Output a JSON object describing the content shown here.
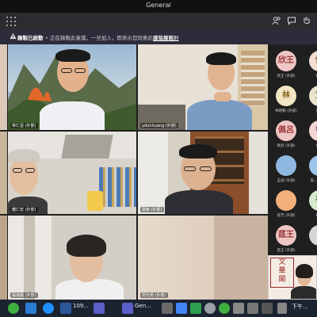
{
  "window": {
    "title": "General"
  },
  "banner": {
    "bold": "錄製已啟動",
    "message": "• 正在錄製此會議，一旦加入，即表示您同意此會議錄製。",
    "link": "隱私權原則"
  },
  "participants": {
    "tile_names": [
      "林仁昱 (外部)",
      "ydunhuang (外部)",
      "",
      "鍾仁宏 (外部)",
      "梁敏 (外部)",
      "",
      "張淑鳳 (外部)",
      "周光苑 (外部)",
      ""
    ]
  },
  "roster": [
    {
      "initials": "欣王",
      "name": "欣王 (外部)",
      "bg": "#efc6c6",
      "fg": "#9b3a3a"
    },
    {
      "initials": "怡",
      "name": "怡...",
      "bg": "#f2ddd1",
      "fg": "#9b5a3a"
    },
    {
      "initials": "林",
      "name": "林明勳 (外部)",
      "bg": "#f3e6c5",
      "fg": "#8a6a20"
    },
    {
      "initials": "宜",
      "name": "宜...",
      "bg": "#e9e3cc",
      "fg": "#8a7a3a"
    },
    {
      "initials": "佩呂",
      "name": "佩呂 (外部)",
      "bg": "#efc6c6",
      "fg": "#9b3a3a"
    },
    {
      "initials": "睿",
      "name": "睿...",
      "bg": "#f2d6d6",
      "fg": "#9b3a3a"
    },
    {
      "initials": "",
      "name": "孟涵 (外部)",
      "bg": "#8fb8e0",
      "fg": "#ffffff"
    },
    {
      "initials": "",
      "name": "安... (外部)",
      "bg": "#9ec4ec",
      "fg": "#ffffff"
    },
    {
      "initials": "",
      "name": "晉芳 (外部)",
      "bg": "#f3b07a",
      "fg": "#ffffff"
    },
    {
      "initials": "祐",
      "name": "祐...",
      "bg": "#d7ead0",
      "fg": "#3a7a3a"
    },
    {
      "initials": "莛王",
      "name": "莛王 (外部)",
      "bg": "#efc6c6",
      "fg": "#9b3a3a"
    },
    {
      "initials": "",
      "name": "",
      "bg": "#d6d6d6",
      "fg": "#555555"
    }
  ],
  "taskbar": {
    "word_label": "109...",
    "teams_label": "Gen...",
    "time": "下午..."
  },
  "colors": {
    "banner_bg": "#2d2c3b",
    "titlebar_bg": "#111111",
    "taskbar_bg": "#1b2330",
    "teams_purple": "#5b5fc7"
  }
}
